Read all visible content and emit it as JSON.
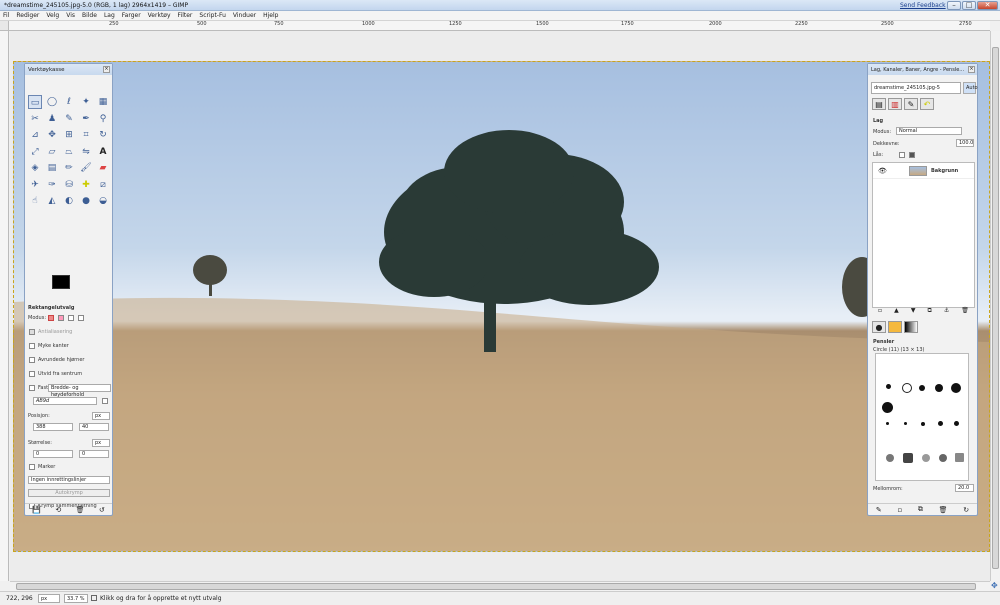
{
  "window": {
    "title": "*dreamstime_245105.jpg-5.0 (RGB, 1 lag) 2964x1419 – GIMP",
    "send_feedback": "Send Feedback",
    "minimize": "–",
    "maximize": "□",
    "close": "✕"
  },
  "menu": [
    "Fil",
    "Rediger",
    "Velg",
    "Vis",
    "Bilde",
    "Lag",
    "Farger",
    "Verktøy",
    "Filter",
    "Script-Fu",
    "Vinduer",
    "Hjelp"
  ],
  "ruler": {
    "marks": [
      "250",
      "500",
      "750",
      "1000",
      "1250",
      "1500",
      "1750",
      "2000",
      "2250",
      "2500",
      "2750"
    ]
  },
  "toolbox": {
    "title": "Verktøykasse",
    "tools": [
      "rect-select",
      "ellipse-select",
      "free-select",
      "fuzzy-select",
      "select-by-color",
      "scissors",
      "foreground-select",
      "paths",
      "color-picker",
      "zoom",
      "measure",
      "move",
      "align",
      "crop",
      "rotate",
      "scale",
      "shear",
      "perspective",
      "flip",
      "text",
      "bucket-fill",
      "blend",
      "pencil",
      "paintbrush",
      "eraser",
      "airbrush",
      "ink",
      "clone",
      "heal",
      "perspective-clone",
      "smudge",
      "sharpen",
      "dodge",
      "blur",
      "convolve"
    ],
    "options_title": "Rektangelutvalg",
    "mode_label": "Modus:",
    "antialiasing": "Antialiasering",
    "feather": "Myke kanter",
    "rounded": "Avrundede hjørner",
    "expand_center": "Utvid fra sentrum",
    "fixed_label": "Fast",
    "fixed_value": "Bredde- og høydeforhold",
    "ratio_value": "AB9d",
    "position_label": "Posisjon:",
    "pos_unit": "px",
    "pos_x": "388",
    "pos_y": "40",
    "size_label": "Størrelse:",
    "size_unit": "px",
    "size_w": "0",
    "size_h": "0",
    "highlight": "Marker",
    "guides": "Ingen innrettingslinjer",
    "autocrop": "Autokrymp",
    "shrink_merged": "Krymp sammenfletning"
  },
  "dock": {
    "title": "Lag, Kanaler, Baner, Angre - Pensle...",
    "image_selector": "dreamstime_245105.jpg-5",
    "auto_button": "Auto",
    "layers_title": "Lag",
    "mode_label": "Modus:",
    "mode_value": "Normal",
    "opacity_label": "Dekkevne:",
    "opacity_value": "100.0",
    "lock_label": "Lås:",
    "layer_name": "Bakgrunn",
    "brushes_title": "Pensler",
    "brush_name": "Circle (11) (13 × 13)",
    "spacing_label": "Mellomrom:",
    "spacing_value": "20.0"
  },
  "statusbar": {
    "coords": "722, 296",
    "unit": "px",
    "zoom": "33.7 %",
    "message": "Klikk og dra for å opprette et nytt utvalg"
  }
}
